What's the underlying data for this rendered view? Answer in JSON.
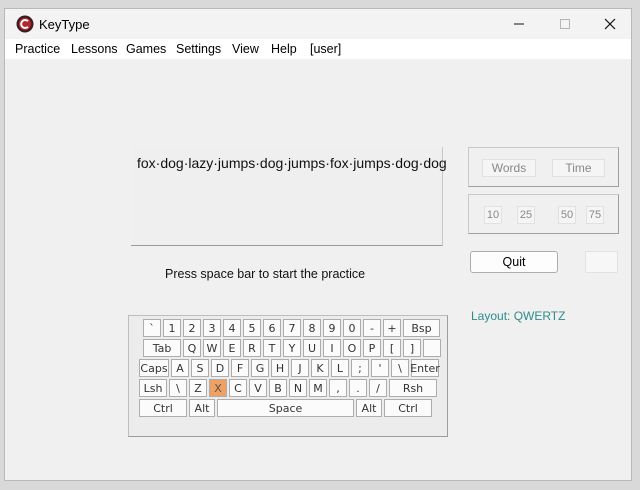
{
  "window": {
    "title": "KeyType",
    "controls": {
      "minimize": "minimize",
      "maximize": "maximize",
      "close": "close"
    }
  },
  "menu": [
    "Practice",
    "Lessons",
    "Games",
    "Settings",
    "View",
    "Help",
    "[user]"
  ],
  "practice": {
    "text": "fox·dog·lazy·jumps·dog·jumps·fox·jumps·dog·dog",
    "status": "Press space bar to start the practice"
  },
  "mode": {
    "words": "Words",
    "time": "Time"
  },
  "counts": [
    "10",
    "25",
    "50",
    "75"
  ],
  "buttons": {
    "quit": "Quit"
  },
  "layout_label": "Layout: QWERTZ",
  "colors": {
    "highlight_key": "#f0a060",
    "layout_label": "#2e8b8b",
    "logo": "#b3262e"
  },
  "keyboard": {
    "highlighted": "X",
    "rows": [
      [
        "`",
        "1",
        "2",
        "3",
        "4",
        "5",
        "6",
        "7",
        "8",
        "9",
        "0",
        "-",
        "+",
        "Bsp"
      ],
      [
        "Tab",
        "Q",
        "W",
        "E",
        "R",
        "T",
        "Y",
        "U",
        "I",
        "O",
        "P",
        "[",
        "]",
        ""
      ],
      [
        "Caps",
        "A",
        "S",
        "D",
        "F",
        "G",
        "H",
        "J",
        "K",
        "L",
        ";",
        "'",
        "\\",
        "Enter"
      ],
      [
        "Lsh",
        "\\",
        "Z",
        "X",
        "C",
        "V",
        "B",
        "N",
        "M",
        ",",
        ".",
        "/",
        "Rsh"
      ],
      [
        "Ctrl",
        "Alt",
        "Space",
        "Alt",
        "Ctrl"
      ]
    ]
  }
}
